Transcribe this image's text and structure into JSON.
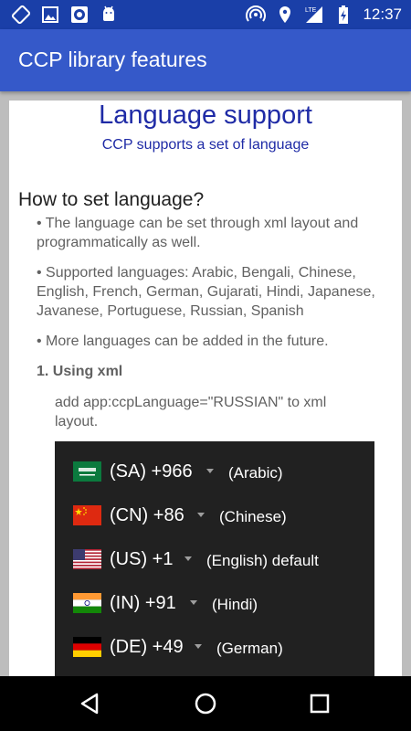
{
  "status_bar": {
    "time": "12:37",
    "left_icons": [
      "screen-rotation-icon",
      "image-icon",
      "record-icon",
      "android-icon"
    ],
    "right_icons": [
      "hotspot-icon",
      "location-icon",
      "signal-lte-icon",
      "battery-charging-icon"
    ]
  },
  "app_bar": {
    "title": "CCP library features"
  },
  "content": {
    "title": "Language support",
    "subtitle": "CCP supports a set of language",
    "section_heading": "How to set language?",
    "bullet_1": "• The language can be set through xml layout and programmatically as well.",
    "bullet_2": "• Supported languages: Arabic, Bengali, Chinese, English, French, German, Gujarati, Hindi, Japanese, Javanese, Portuguese, Russian, Spanish",
    "bullet_3": "• More languages can be added in the future.",
    "subheading": "1. Using xml",
    "instruction": "add app:ccpLanguage=\"RUSSIAN\" to xml layout."
  },
  "picker_rows": [
    {
      "flag": "saudi-arabia-flag-icon",
      "code": "(SA)  +966",
      "language": "(Arabic)"
    },
    {
      "flag": "china-flag-icon",
      "code": "(CN)  +86",
      "language": "(Chinese)"
    },
    {
      "flag": "usa-flag-icon",
      "code": "(US)  +1",
      "language": "(English) default"
    },
    {
      "flag": "india-flag-icon",
      "code": "(IN)  +91",
      "language": "(Hindi)"
    },
    {
      "flag": "germany-flag-icon",
      "code": "(DE)  +49",
      "language": "(German)"
    }
  ],
  "nav_bar": {
    "buttons": [
      "back-icon",
      "home-icon",
      "recents-icon"
    ]
  },
  "colors": {
    "status_bar": "#1a3fa8",
    "app_bar": "#3559c9",
    "accent_text": "#1f2ba6",
    "panel": "#212121"
  }
}
